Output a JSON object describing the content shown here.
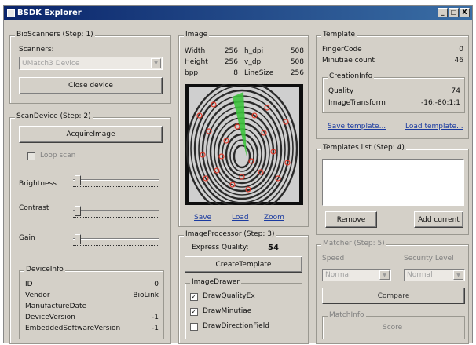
{
  "window": {
    "title": "BSDK Explorer",
    "min": "_",
    "max": "□",
    "close": "X"
  },
  "bioscanners": {
    "title": "BioScanners (Step: 1)",
    "scanners_label": "Scanners:",
    "scanner_value": "UMatch3 Device",
    "close_button": "Close device"
  },
  "scandevice": {
    "title": "ScanDevice (Step: 2)",
    "acquire_button": "AcquireImage",
    "loop_scan": "Loop scan",
    "brightness": "Brightness",
    "contrast": "Contrast",
    "gain": "Gain"
  },
  "deviceinfo": {
    "title": "DeviceInfo",
    "rows": [
      {
        "label": "ID",
        "value": "0"
      },
      {
        "label": "Vendor",
        "value": "BioLink"
      },
      {
        "label": "ManufactureDate",
        "value": ""
      },
      {
        "label": "DeviceVersion",
        "value": "-1"
      },
      {
        "label": "EmbeddedSoftwareVersion",
        "value": "-1"
      }
    ]
  },
  "image": {
    "title": "Image",
    "rows": [
      {
        "l1": "Width",
        "v1": "256",
        "l2": "h_dpi",
        "v2": "508"
      },
      {
        "l1": "Height",
        "v1": "256",
        "l2": "v_dpi",
        "v2": "508"
      },
      {
        "l1": "bpp",
        "v1": "8",
        "l2": "LineSize",
        "v2": "256"
      }
    ],
    "save": "Save",
    "load": "Load",
    "zoom": "Zoom"
  },
  "processor": {
    "title": "ImageProcessor (Step: 3)",
    "express_label": "Express Quality:",
    "express_value": "54",
    "create_button": "CreateTemplate"
  },
  "drawer": {
    "title": "ImageDrawer",
    "items": [
      {
        "label": "DrawQualityEx",
        "checked": "✓"
      },
      {
        "label": "DrawMinutiae",
        "checked": "✓"
      },
      {
        "label": "DrawDirectionField",
        "checked": ""
      }
    ]
  },
  "template": {
    "title": "Template",
    "fingercode_label": "FingerCode",
    "fingercode_value": "0",
    "minutiae_label": "Minutiae count",
    "minutiae_value": "46",
    "creation_title": "CreationInfo",
    "quality_label": "Quality",
    "quality_value": "74",
    "transform_label": "ImageTransform",
    "transform_value": "-16;-80;1;1",
    "save_link": "Save template...",
    "load_link": "Load template..."
  },
  "templates_list": {
    "title": "Templates list (Step: 4)",
    "remove": "Remove",
    "add": "Add current"
  },
  "matcher": {
    "title": "Matcher (Step: 5)",
    "speed_label": "Speed",
    "speed_value": "Normal",
    "security_label": "Security Level",
    "security_value": "Normal",
    "compare": "Compare",
    "matchinfo": "MatchInfo",
    "score": "Score"
  }
}
